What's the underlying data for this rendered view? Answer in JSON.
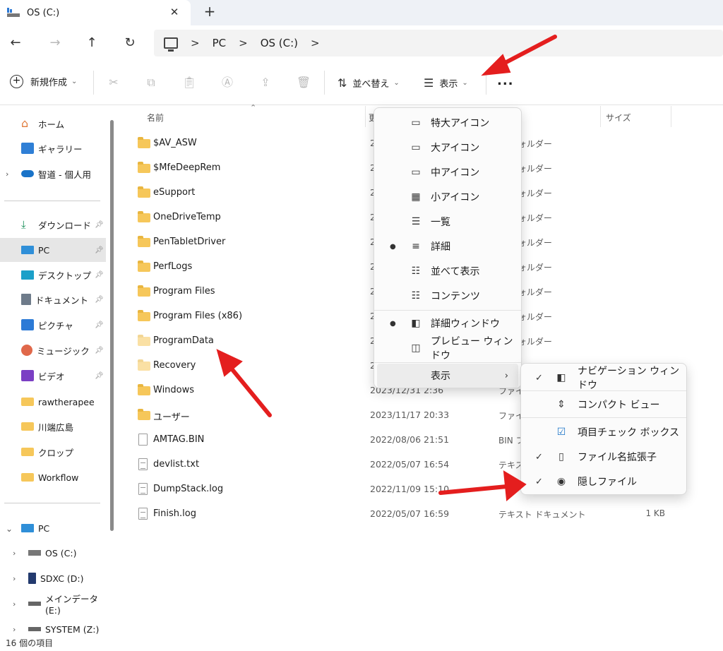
{
  "tab": {
    "title": "OS (C:)",
    "close": "✕",
    "new": "+"
  },
  "address": {
    "crumbs": [
      "PC",
      "OS (C:)"
    ],
    "sep": ">"
  },
  "nav": {
    "back": "←",
    "forward": "→",
    "up": "↑",
    "refresh": "↻"
  },
  "toolbar": {
    "new_label": "新規作成",
    "sort_label": "並べ替え",
    "view_label": "表示",
    "more_label": "..."
  },
  "sidebar": {
    "home": "ホーム",
    "gallery": "ギャラリー",
    "onedrive": "智道 - 個人用",
    "quick": [
      "ダウンロード",
      "PC",
      "デスクトップ",
      "ドキュメント",
      "ピクチャ",
      "ミュージック",
      "ビデオ",
      "rawtherapee",
      "川端広島",
      "クロップ",
      "Workflow"
    ],
    "pc_root": "PC",
    "drives": [
      "OS (C:)",
      "SDXC (D:)",
      "メインデータ (E:)",
      "SYSTEM (Z:)"
    ]
  },
  "columns": {
    "name": "名前",
    "date": "更",
    "size": "サイズ"
  },
  "files": [
    {
      "name": "$AV_ASW",
      "date": "2",
      "type": "ル フォルダー",
      "size": ""
    },
    {
      "name": "$MfeDeepRem",
      "date": "2",
      "type": "ル フォルダー",
      "size": ""
    },
    {
      "name": "eSupport",
      "date": "2",
      "type": "ル フォルダー",
      "size": ""
    },
    {
      "name": "OneDriveTemp",
      "date": "2",
      "type": "ル フォルダー",
      "size": ""
    },
    {
      "name": "PenTabletDriver",
      "date": "2",
      "type": "ル フォルダー",
      "size": ""
    },
    {
      "name": "PerfLogs",
      "date": "2",
      "type": "ル フォルダー",
      "size": ""
    },
    {
      "name": "Program Files",
      "date": "2",
      "type": "ル フォルダー",
      "size": ""
    },
    {
      "name": "Program Files (x86)",
      "date": "2",
      "type": "ル フォルダー",
      "size": ""
    },
    {
      "name": "ProgramData",
      "date": "2",
      "type": "ル フォルダー",
      "size": ""
    },
    {
      "name": "Recovery",
      "date": "2",
      "type": "",
      "size": ""
    },
    {
      "name": "Windows",
      "date": "2023/12/31 2:36",
      "type": "ファイ",
      "size": ""
    },
    {
      "name": "ユーザー",
      "date": "2023/11/17 20:33",
      "type": "ファイ",
      "size": ""
    },
    {
      "name": "AMTAG.BIN",
      "date": "2022/08/06 21:51",
      "type": "BIN フ",
      "size": ""
    },
    {
      "name": "devlist.txt",
      "date": "2022/05/07 16:54",
      "type": "テキス",
      "size": ""
    },
    {
      "name": "DumpStack.log",
      "date": "2022/11/09 15:10",
      "type": "",
      "size": ""
    },
    {
      "name": "Finish.log",
      "date": "2022/05/07 16:59",
      "type": "テキスト ドキュメント",
      "size": "1 KB"
    }
  ],
  "view_menu": [
    {
      "label": "特大アイコン",
      "icon": "▭"
    },
    {
      "label": "大アイコン",
      "icon": "▭"
    },
    {
      "label": "中アイコン",
      "icon": "▭"
    },
    {
      "label": "小アイコン",
      "icon": "▦"
    },
    {
      "label": "一覧",
      "icon": "☰"
    },
    {
      "label": "詳細",
      "icon": "≡"
    },
    {
      "label": "並べて表示",
      "icon": "☷"
    },
    {
      "label": "コンテンツ",
      "icon": "☷"
    },
    {
      "label": "詳細ウィンドウ",
      "icon": "◧"
    },
    {
      "label": "プレビュー ウィンドウ",
      "icon": "◫"
    },
    {
      "label": "表示",
      "icon": ""
    }
  ],
  "show_menu": [
    {
      "label": "ナビゲーション ウィンドウ",
      "icon": "◧",
      "checked": "✓"
    },
    {
      "label": "コンパクト ビュー",
      "icon": "⇕",
      "checked": ""
    },
    {
      "label": "項目チェック ボックス",
      "icon": "☑",
      "checked": ""
    },
    {
      "label": "ファイル名拡張子",
      "icon": "▯",
      "checked": "✓"
    },
    {
      "label": "隠しファイル",
      "icon": "◉",
      "checked": "✓"
    }
  ],
  "status": {
    "count": "16 個の項目"
  },
  "colors": {
    "folder": "#f6c75a",
    "arrow": "#e41e1e",
    "selected": "#e6e6e6"
  }
}
